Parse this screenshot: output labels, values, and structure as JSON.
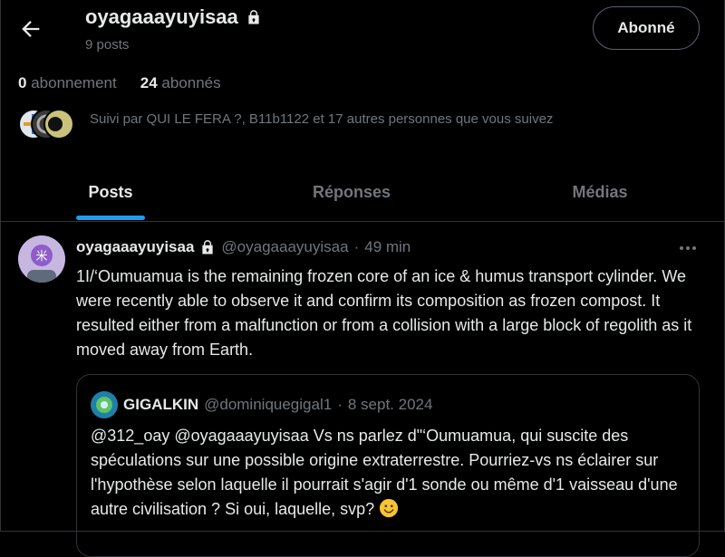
{
  "profile": {
    "name": "oyagaaayuyisaa",
    "posts_count": "9 posts",
    "subscribe_label": "Abonné",
    "following_count": "0",
    "following_label": "abonnement",
    "followers_count": "24",
    "followers_label": "abonnés",
    "followed_by": "Suivi par QUI LE FERA ?, B11b1122 et 17 autres personnes que vous suivez"
  },
  "tabs": [
    {
      "label": "Posts",
      "active": true
    },
    {
      "label": "Réponses",
      "active": false
    },
    {
      "label": "Médias",
      "active": false
    }
  ],
  "tweet": {
    "name": "oyagaaayuyisaa",
    "handle": "@oyagaaayuyisaa",
    "separator": "·",
    "time": "49 min",
    "text": "1I/‘Oumuamua is the remaining frozen core of an ice & humus transport cylinder. We were recently able to observe it and confirm its composition as frozen compost. It resulted either from a malfunction or from a collision with a large block of regolith as it moved away from Earth."
  },
  "quote": {
    "name": "GIGALKIN",
    "handle": "@dominiquegigal1",
    "separator": "·",
    "date": "8 sept. 2024",
    "text": "@312_oay @oyagaaayuyisaa Vs ns parlez d\"‘Oumuamua, qui suscite des spéculations sur une possible origine extraterrestre. Pourriez-vs ns éclairer sur l'hypothèse selon laquelle il pourrait s'agir d'1 sonde ou même d'1 vaisseau d'une autre civilisation ? Si oui, laquelle, svp? "
  },
  "icons": [
    "back-arrow-icon",
    "lock-icon",
    "more-icon",
    "smile-emoji-icon"
  ],
  "colors": {
    "accent": "#1d9bf0",
    "muted": "#71767b",
    "text": "#e7e9ea",
    "background": "#000000"
  }
}
